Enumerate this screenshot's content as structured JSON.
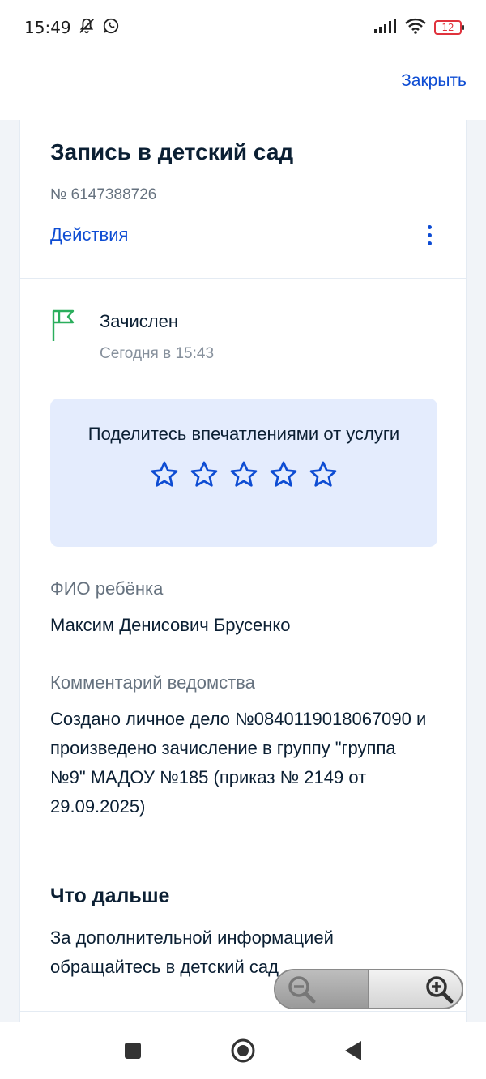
{
  "status_bar": {
    "time": "15:49",
    "battery": "12",
    "icons": [
      "mute-bell-icon",
      "whatsapp-icon",
      "signal-icon",
      "wifi-icon",
      "battery-icon"
    ]
  },
  "header": {
    "close_label": "Закрыть"
  },
  "application": {
    "title": "Запись в детский сад",
    "number": "№ 6147388726",
    "actions_label": "Действия"
  },
  "status": {
    "title": "Зачислен",
    "time": "Сегодня в 15:43",
    "icon": "flag-icon",
    "color": "#2aae5c"
  },
  "rating": {
    "prompt": "Поделитесь впечатлениями от услуги",
    "stars_total": 5,
    "stars_selected": 0
  },
  "child": {
    "label": "ФИО ребёнка",
    "value": "Максим Денисович Брусенко"
  },
  "comment": {
    "label": "Комментарий ведомства",
    "value": "Создано личное дело №0840119018067090 и произведено зачисление в группу \"группа №9\" МАДОУ №185 (приказ № 2149 от 29.09.2025)"
  },
  "next": {
    "title": "Что дальше",
    "text": "За дополнительной информацией обращайтесь в детский сад"
  },
  "colors": {
    "accent": "#0d4cd3",
    "rate_bg": "#e4ecfd",
    "success": "#2aae5c"
  },
  "nav": {
    "icons": [
      "recents-square-icon",
      "home-circle-icon",
      "back-triangle-icon"
    ]
  }
}
